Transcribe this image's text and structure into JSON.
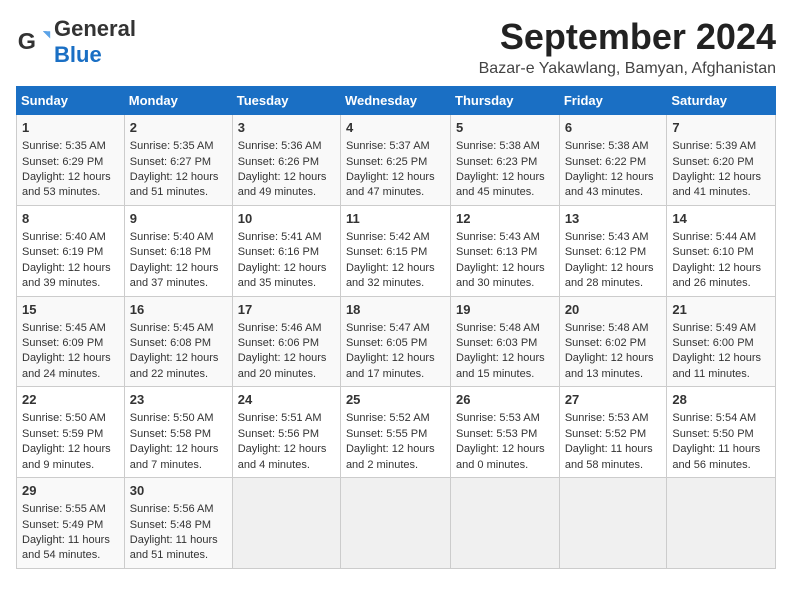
{
  "logo": {
    "general": "General",
    "blue": "Blue"
  },
  "title": "September 2024",
  "subtitle": "Bazar-e Yakawlang, Bamyan, Afghanistan",
  "days_header": [
    "Sunday",
    "Monday",
    "Tuesday",
    "Wednesday",
    "Thursday",
    "Friday",
    "Saturday"
  ],
  "weeks": [
    [
      {
        "day": "1",
        "sunrise": "Sunrise: 5:35 AM",
        "sunset": "Sunset: 6:29 PM",
        "daylight": "Daylight: 12 hours and 53 minutes."
      },
      {
        "day": "2",
        "sunrise": "Sunrise: 5:35 AM",
        "sunset": "Sunset: 6:27 PM",
        "daylight": "Daylight: 12 hours and 51 minutes."
      },
      {
        "day": "3",
        "sunrise": "Sunrise: 5:36 AM",
        "sunset": "Sunset: 6:26 PM",
        "daylight": "Daylight: 12 hours and 49 minutes."
      },
      {
        "day": "4",
        "sunrise": "Sunrise: 5:37 AM",
        "sunset": "Sunset: 6:25 PM",
        "daylight": "Daylight: 12 hours and 47 minutes."
      },
      {
        "day": "5",
        "sunrise": "Sunrise: 5:38 AM",
        "sunset": "Sunset: 6:23 PM",
        "daylight": "Daylight: 12 hours and 45 minutes."
      },
      {
        "day": "6",
        "sunrise": "Sunrise: 5:38 AM",
        "sunset": "Sunset: 6:22 PM",
        "daylight": "Daylight: 12 hours and 43 minutes."
      },
      {
        "day": "7",
        "sunrise": "Sunrise: 5:39 AM",
        "sunset": "Sunset: 6:20 PM",
        "daylight": "Daylight: 12 hours and 41 minutes."
      }
    ],
    [
      {
        "day": "8",
        "sunrise": "Sunrise: 5:40 AM",
        "sunset": "Sunset: 6:19 PM",
        "daylight": "Daylight: 12 hours and 39 minutes."
      },
      {
        "day": "9",
        "sunrise": "Sunrise: 5:40 AM",
        "sunset": "Sunset: 6:18 PM",
        "daylight": "Daylight: 12 hours and 37 minutes."
      },
      {
        "day": "10",
        "sunrise": "Sunrise: 5:41 AM",
        "sunset": "Sunset: 6:16 PM",
        "daylight": "Daylight: 12 hours and 35 minutes."
      },
      {
        "day": "11",
        "sunrise": "Sunrise: 5:42 AM",
        "sunset": "Sunset: 6:15 PM",
        "daylight": "Daylight: 12 hours and 32 minutes."
      },
      {
        "day": "12",
        "sunrise": "Sunrise: 5:43 AM",
        "sunset": "Sunset: 6:13 PM",
        "daylight": "Daylight: 12 hours and 30 minutes."
      },
      {
        "day": "13",
        "sunrise": "Sunrise: 5:43 AM",
        "sunset": "Sunset: 6:12 PM",
        "daylight": "Daylight: 12 hours and 28 minutes."
      },
      {
        "day": "14",
        "sunrise": "Sunrise: 5:44 AM",
        "sunset": "Sunset: 6:10 PM",
        "daylight": "Daylight: 12 hours and 26 minutes."
      }
    ],
    [
      {
        "day": "15",
        "sunrise": "Sunrise: 5:45 AM",
        "sunset": "Sunset: 6:09 PM",
        "daylight": "Daylight: 12 hours and 24 minutes."
      },
      {
        "day": "16",
        "sunrise": "Sunrise: 5:45 AM",
        "sunset": "Sunset: 6:08 PM",
        "daylight": "Daylight: 12 hours and 22 minutes."
      },
      {
        "day": "17",
        "sunrise": "Sunrise: 5:46 AM",
        "sunset": "Sunset: 6:06 PM",
        "daylight": "Daylight: 12 hours and 20 minutes."
      },
      {
        "day": "18",
        "sunrise": "Sunrise: 5:47 AM",
        "sunset": "Sunset: 6:05 PM",
        "daylight": "Daylight: 12 hours and 17 minutes."
      },
      {
        "day": "19",
        "sunrise": "Sunrise: 5:48 AM",
        "sunset": "Sunset: 6:03 PM",
        "daylight": "Daylight: 12 hours and 15 minutes."
      },
      {
        "day": "20",
        "sunrise": "Sunrise: 5:48 AM",
        "sunset": "Sunset: 6:02 PM",
        "daylight": "Daylight: 12 hours and 13 minutes."
      },
      {
        "day": "21",
        "sunrise": "Sunrise: 5:49 AM",
        "sunset": "Sunset: 6:00 PM",
        "daylight": "Daylight: 12 hours and 11 minutes."
      }
    ],
    [
      {
        "day": "22",
        "sunrise": "Sunrise: 5:50 AM",
        "sunset": "Sunset: 5:59 PM",
        "daylight": "Daylight: 12 hours and 9 minutes."
      },
      {
        "day": "23",
        "sunrise": "Sunrise: 5:50 AM",
        "sunset": "Sunset: 5:58 PM",
        "daylight": "Daylight: 12 hours and 7 minutes."
      },
      {
        "day": "24",
        "sunrise": "Sunrise: 5:51 AM",
        "sunset": "Sunset: 5:56 PM",
        "daylight": "Daylight: 12 hours and 4 minutes."
      },
      {
        "day": "25",
        "sunrise": "Sunrise: 5:52 AM",
        "sunset": "Sunset: 5:55 PM",
        "daylight": "Daylight: 12 hours and 2 minutes."
      },
      {
        "day": "26",
        "sunrise": "Sunrise: 5:53 AM",
        "sunset": "Sunset: 5:53 PM",
        "daylight": "Daylight: 12 hours and 0 minutes."
      },
      {
        "day": "27",
        "sunrise": "Sunrise: 5:53 AM",
        "sunset": "Sunset: 5:52 PM",
        "daylight": "Daylight: 11 hours and 58 minutes."
      },
      {
        "day": "28",
        "sunrise": "Sunrise: 5:54 AM",
        "sunset": "Sunset: 5:50 PM",
        "daylight": "Daylight: 11 hours and 56 minutes."
      }
    ],
    [
      {
        "day": "29",
        "sunrise": "Sunrise: 5:55 AM",
        "sunset": "Sunset: 5:49 PM",
        "daylight": "Daylight: 11 hours and 54 minutes."
      },
      {
        "day": "30",
        "sunrise": "Sunrise: 5:56 AM",
        "sunset": "Sunset: 5:48 PM",
        "daylight": "Daylight: 11 hours and 51 minutes."
      },
      null,
      null,
      null,
      null,
      null
    ]
  ]
}
